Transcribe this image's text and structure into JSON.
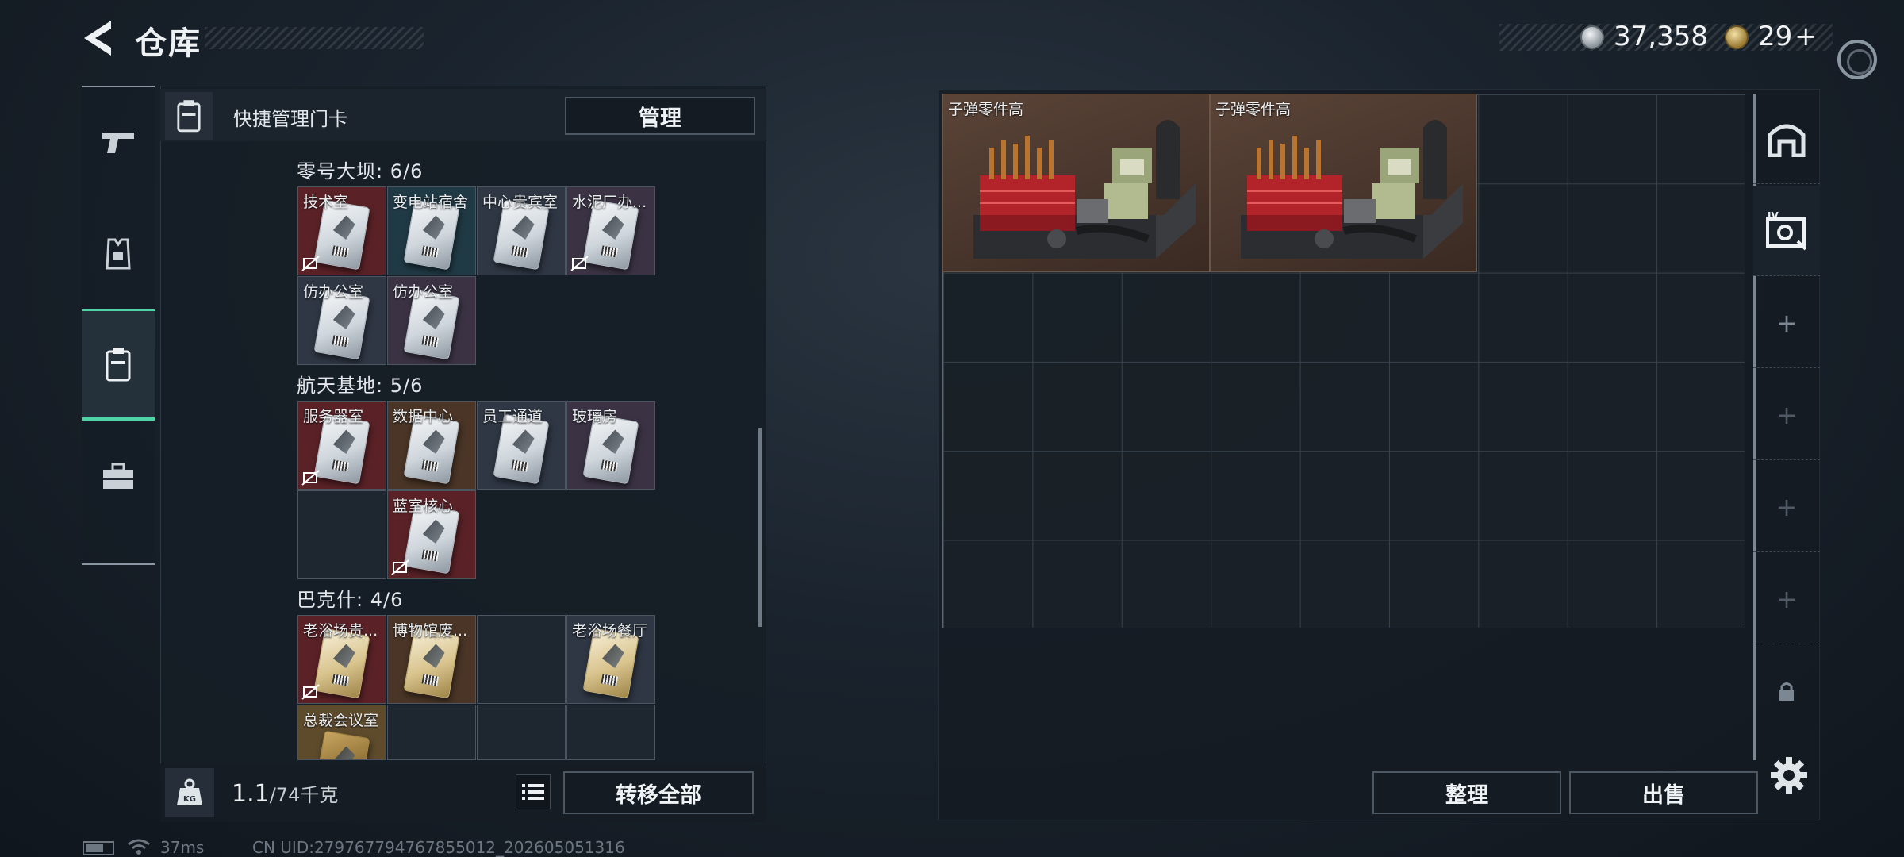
{
  "header": {
    "title": "仓库"
  },
  "currency": {
    "silver": "37,358",
    "gold": "29",
    "gold_add": "+"
  },
  "keycard_panel": {
    "header_label": "快捷管理门卡",
    "manage_label": "管理",
    "sections": [
      {
        "title": "零号大坝: 6/6",
        "cards": [
          {
            "label": "技术室",
            "bg": "red",
            "nosell": true
          },
          {
            "label": "变电站宿舍",
            "bg": "teal",
            "nosell": false
          },
          {
            "label": "中心贵宾室",
            "bg": "slate",
            "nosell": false
          },
          {
            "label": "水泥厂办...",
            "bg": "purple",
            "nosell": true
          },
          {
            "label": "仿办公室",
            "bg": "slate",
            "nosell": false
          },
          {
            "label": "仿办公室",
            "bg": "purple",
            "nosell": false
          }
        ]
      },
      {
        "title": "航天基地: 5/6",
        "cards": [
          {
            "label": "服务器室",
            "bg": "red",
            "nosell": true
          },
          {
            "label": "数据中心",
            "bg": "brown",
            "nosell": false
          },
          {
            "label": "员工通道",
            "bg": "slate",
            "nosell": false
          },
          {
            "label": "玻璃房",
            "bg": "purple",
            "nosell": false
          },
          {
            "label": "蓝室核心",
            "bg": "red",
            "nosell": true
          }
        ]
      },
      {
        "title": "巴克什: 4/6",
        "cards": [
          {
            "label": "老浴场贵...",
            "bg": "red",
            "nosell": true
          },
          {
            "label": "博物馆废...",
            "bg": "brown",
            "nosell": false
          },
          {
            "label": "老浴场餐厅",
            "bg": "slate",
            "nosell": false
          },
          {
            "label": "总裁会议室",
            "bg": "gold",
            "nosell": false
          }
        ]
      }
    ],
    "weight_value": "1.1",
    "weight_max": "/74千克",
    "transfer_all_label": "转移全部"
  },
  "stash": {
    "items": [
      {
        "label": "子弹零件高"
      },
      {
        "label": "子弹零件高"
      }
    ],
    "sort_label": "整理",
    "sell_label": "出售"
  },
  "status_bar": {
    "ping": "37ms",
    "uid": "CN UID:279767794767855012_202605051316"
  },
  "colors": {
    "accent": "#4fd3a4",
    "slot_red": "#5a2227",
    "slot_gold": "#5e4b2c"
  }
}
